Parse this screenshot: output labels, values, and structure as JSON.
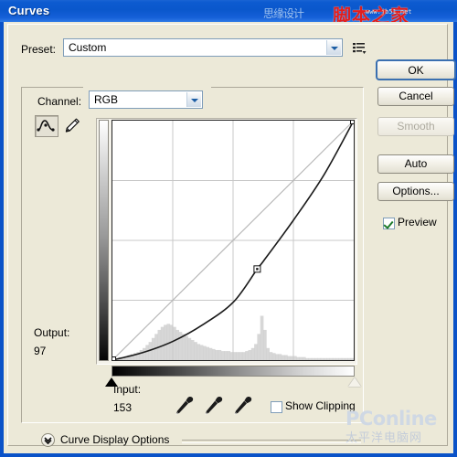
{
  "window": {
    "title": "Curves"
  },
  "watermarks": {
    "title_cn": "思缘设计",
    "title_red": "脚本之家",
    "title_url": "www.jb51.net",
    "footer_main": "PConline",
    "footer_cn": "太平洋电脑网"
  },
  "preset": {
    "label": "Preset:",
    "value": "Custom",
    "menu_icon": "preset-menu-icon"
  },
  "channel": {
    "label": "Channel:",
    "value": "RGB"
  },
  "tools": {
    "curve_icon": "curve-tool-icon",
    "pencil_icon": "pencil-tool-icon",
    "selected": "curve"
  },
  "readout": {
    "output_label": "Output:",
    "output_value": "97",
    "input_label": "Input:",
    "input_value": "153"
  },
  "eyedroppers": [
    {
      "name": "set-black-point",
      "icon": "eyedropper-icon"
    },
    {
      "name": "set-gray-point",
      "icon": "eyedropper-icon"
    },
    {
      "name": "set-white-point",
      "icon": "eyedropper-icon"
    }
  ],
  "show_clipping": {
    "label": "Show Clipping",
    "checked": false
  },
  "preview": {
    "label": "Preview",
    "checked": true
  },
  "buttons": {
    "ok": "OK",
    "cancel": "Cancel",
    "smooth": "Smooth",
    "auto": "Auto",
    "options": "Options..."
  },
  "curve_display_options": {
    "label": "Curve Display Options",
    "expander_icon": "chevron-down-icon",
    "expanded": false
  },
  "colors": {
    "titlebar_blue": "#0a57cc",
    "dialog_face": "#ece9d8",
    "curve_line": "#1a1a1a",
    "baseline": "#b9b9b9",
    "grid_line": "#c8c8c8",
    "histogram": "#c9c9c9",
    "checkmark_green": "#1d7a2a"
  },
  "chart_data": {
    "type": "line",
    "title": "Curves",
    "xlabel": "Input",
    "ylabel": "Output",
    "xlim": [
      0,
      255
    ],
    "ylim": [
      0,
      255
    ],
    "grid": true,
    "grid_divisions": 4,
    "series": [
      {
        "name": "baseline",
        "style": "straight-diagonal",
        "x": [
          0,
          255
        ],
        "y": [
          0,
          255
        ]
      },
      {
        "name": "rgb-curve",
        "style": "curve",
        "x": [
          0,
          32,
          64,
          96,
          128,
          153,
          160,
          192,
          224,
          255
        ],
        "y": [
          0,
          8,
          20,
          38,
          62,
          97,
          106,
          150,
          198,
          255
        ]
      }
    ],
    "control_points": [
      {
        "input": 0,
        "output": 0
      },
      {
        "input": 153,
        "output": 97
      },
      {
        "input": 255,
        "output": 255
      }
    ],
    "selected_point": {
      "input": 153,
      "output": 97
    },
    "histogram": {
      "bins": [
        2,
        2,
        3,
        3,
        4,
        5,
        6,
        7,
        8,
        10,
        12,
        15,
        18,
        22,
        26,
        30,
        33,
        35,
        36,
        35,
        33,
        30,
        28,
        26,
        24,
        22,
        20,
        18,
        16,
        15,
        14,
        13,
        12,
        11,
        10,
        10,
        9,
        9,
        9,
        8,
        8,
        8,
        8,
        8,
        9,
        10,
        12,
        16,
        26,
        44,
        30,
        12,
        8,
        7,
        6,
        6,
        5,
        5,
        4,
        4,
        4,
        3,
        3,
        3,
        2,
        2,
        2,
        2,
        2,
        2,
        2,
        2,
        2,
        2,
        2,
        2,
        2,
        2,
        2,
        2
      ]
    },
    "black_point_slider": 0,
    "white_point_slider": 255
  }
}
